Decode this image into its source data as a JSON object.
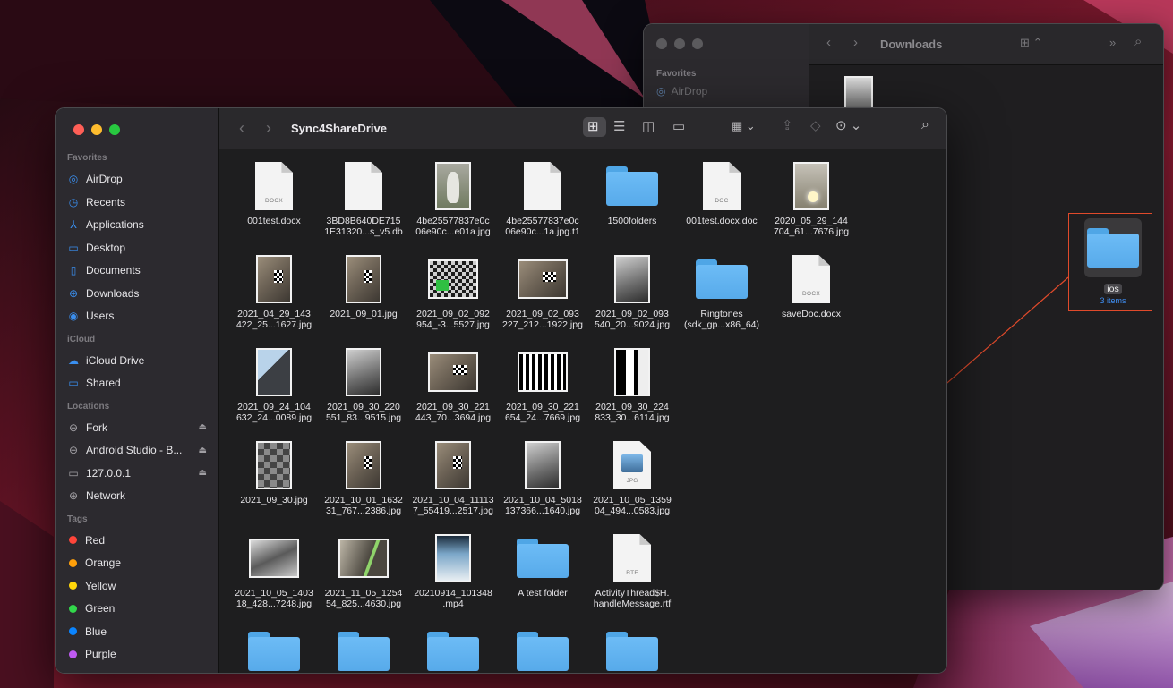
{
  "back_window": {
    "title": "Downloads",
    "sidebar": {
      "section_favorites": "Favorites",
      "item_airdrop": "AirDrop"
    }
  },
  "front_window": {
    "title": "Sync4ShareDrive",
    "sidebar": {
      "favorites_label": "Favorites",
      "favorites": [
        {
          "label": "AirDrop",
          "icon": "airdrop-icon"
        },
        {
          "label": "Recents",
          "icon": "clock-icon"
        },
        {
          "label": "Applications",
          "icon": "applications-icon"
        },
        {
          "label": "Desktop",
          "icon": "desktop-icon"
        },
        {
          "label": "Documents",
          "icon": "document-icon"
        },
        {
          "label": "Downloads",
          "icon": "download-icon"
        },
        {
          "label": "Users",
          "icon": "user-icon"
        }
      ],
      "icloud_label": "iCloud",
      "icloud": [
        {
          "label": "iCloud Drive",
          "icon": "cloud-icon"
        },
        {
          "label": "Shared",
          "icon": "shared-folder-icon"
        }
      ],
      "locations_label": "Locations",
      "locations": [
        {
          "label": "Fork",
          "icon": "drive-icon"
        },
        {
          "label": "Android Studio - B...",
          "icon": "drive-icon"
        },
        {
          "label": "127.0.0.1",
          "icon": "monitor-icon"
        },
        {
          "label": "Network",
          "icon": "network-icon"
        }
      ],
      "tags_label": "Tags",
      "tags": [
        {
          "label": "Red",
          "color": "#ff453a"
        },
        {
          "label": "Orange",
          "color": "#ff9f0a"
        },
        {
          "label": "Yellow",
          "color": "#ffd60a"
        },
        {
          "label": "Green",
          "color": "#32d74b"
        },
        {
          "label": "Blue",
          "color": "#0a84ff"
        },
        {
          "label": "Purple",
          "color": "#bf5af2"
        }
      ]
    },
    "files": [
      {
        "name": "001test.docx",
        "kind": "doc",
        "ext": "DOCX"
      },
      {
        "name": "3BD8B640DE715\n1E31320...s_v5.db",
        "kind": "doc",
        "ext": ""
      },
      {
        "name": "4be25577837e0c\n06e90c...e01a.jpg",
        "kind": "photo",
        "style": "portrait bunny"
      },
      {
        "name": "4be25577837e0c\n06e90c...1a.jpg.t1",
        "kind": "doc",
        "ext": ""
      },
      {
        "name": "1500folders",
        "kind": "folder"
      },
      {
        "name": "001test.docx.doc",
        "kind": "doc",
        "ext": "DOC"
      },
      {
        "name": "2020_05_29_144\n704_61...7676.jpg",
        "kind": "photo",
        "style": "portrait lamp"
      },
      {
        "name": "2021_04_29_143\n422_25...1627.jpg",
        "kind": "photo",
        "style": "portrait room"
      },
      {
        "name": "2021_09_01.jpg",
        "kind": "photo",
        "style": "portrait room"
      },
      {
        "name": "2021_09_02_092\n954_-3...5527.jpg",
        "kind": "photo",
        "style": "landscape greenck"
      },
      {
        "name": "2021_09_02_093\n227_212...1922.jpg",
        "kind": "photo",
        "style": "landscape room"
      },
      {
        "name": "2021_09_02_093\n540_20...9024.jpg",
        "kind": "photo",
        "style": "portrait grey"
      },
      {
        "name": "Ringtones\n(sdk_gp...x86_64)",
        "kind": "folder"
      },
      {
        "name": "saveDoc.docx",
        "kind": "doc",
        "ext": "DOCX"
      },
      {
        "name": "2021_09_24_104\n632_24...0089.jpg",
        "kind": "photo",
        "style": "portrait window"
      },
      {
        "name": "2021_09_30_220\n551_83...9515.jpg",
        "kind": "photo",
        "style": "portrait grey"
      },
      {
        "name": "2021_09_30_221\n443_70...3694.jpg",
        "kind": "photo",
        "style": "landscape room"
      },
      {
        "name": "2021_09_30_221\n654_24...7669.jpg",
        "kind": "photo",
        "style": "landscape bw"
      },
      {
        "name": "2021_09_30_224\n833_30...6114.jpg",
        "kind": "photo",
        "style": "portrait bw2"
      },
      {
        "name": "2021_09_30.jpg",
        "kind": "photo",
        "style": "portrait greyck"
      },
      {
        "name": "2021_10_01_1632\n31_767...2386.jpg",
        "kind": "photo",
        "style": "portrait room"
      },
      {
        "name": "2021_10_04_11113\n7_55419...2517.jpg",
        "kind": "photo",
        "style": "portrait room"
      },
      {
        "name": "2021_10_04_5018\n137366...1640.jpg",
        "kind": "photo",
        "style": "portrait grey"
      },
      {
        "name": "2021_10_05_1359\n04_494...0583.jpg",
        "kind": "jpgdoc",
        "ext": "JPG"
      },
      {
        "name": "2021_10_05_1403\n18_428...7248.jpg",
        "kind": "photo",
        "style": "landscape screen"
      },
      {
        "name": "2021_11_05_1254\n54_825...4630.jpg",
        "kind": "photo",
        "style": "landscape glare"
      },
      {
        "name": "20210914_101348\n.mp4",
        "kind": "photo",
        "style": "portrait phone"
      },
      {
        "name": "A test folder",
        "kind": "folder"
      },
      {
        "name": "ActivityThread$H.\nhandleMessage.rtf",
        "kind": "doc",
        "ext": "RTF"
      },
      {
        "name": "",
        "kind": "folder"
      },
      {
        "name": "",
        "kind": "folder"
      },
      {
        "name": "",
        "kind": "folder"
      },
      {
        "name": "",
        "kind": "folder"
      },
      {
        "name": "",
        "kind": "folder"
      }
    ]
  },
  "desktop": {
    "selected_folder": {
      "label": "ios",
      "sublabel": "3 items"
    },
    "drag_target": {
      "label": "ios"
    }
  },
  "colors": {
    "highlight": "#e04a2b",
    "accent": "#3a8ff0",
    "folder": "#6dbcf6"
  }
}
